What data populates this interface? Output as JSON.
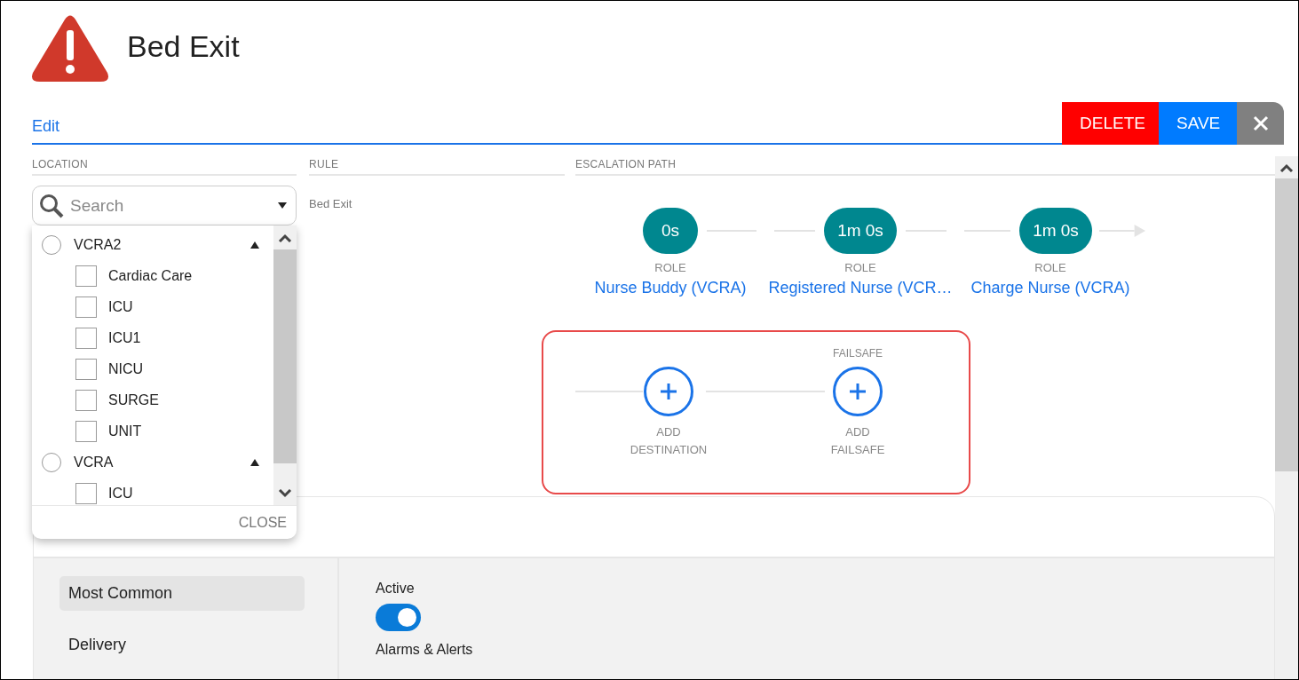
{
  "header": {
    "title": "Bed Exit"
  },
  "tabs": [
    {
      "label": "Edit",
      "selected": true
    }
  ],
  "actions": [
    {
      "kind": "danger",
      "label": "DELETE"
    },
    {
      "kind": "primary",
      "label": "SAVE"
    },
    {
      "kind": "close"
    }
  ],
  "column_headers": [
    "LOCATION",
    "RULE",
    "ESCALATION PATH"
  ],
  "location": {
    "search": {
      "placeholder": "Search"
    },
    "dropdown": {
      "groups": [
        {
          "name": "VCRA2",
          "selected": false,
          "expanded": true,
          "children": [
            {
              "name": "Cardiac Care",
              "checked": false
            },
            {
              "name": "ICU",
              "checked": false
            },
            {
              "name": "ICU1",
              "checked": false
            },
            {
              "name": "NICU",
              "checked": false
            },
            {
              "name": "SURGE",
              "checked": false
            },
            {
              "name": "UNIT",
              "checked": false
            }
          ]
        },
        {
          "name": "VCRA",
          "selected": false,
          "expanded": true,
          "children": [
            {
              "name": "ICU",
              "checked": false
            }
          ]
        }
      ],
      "close_label": "CLOSE"
    }
  },
  "rule": {
    "name": "Bed Exit"
  },
  "escalation": {
    "steps": [
      {
        "delay": "0s",
        "type_label": "ROLE",
        "name": "Nurse Buddy (VCRA)"
      },
      {
        "delay": "1m 0s",
        "type_label": "ROLE",
        "name": "Registered Nurse (VCR…"
      },
      {
        "delay": "1m 0s",
        "type_label": "ROLE",
        "name": "Charge Nurse (VCRA)"
      }
    ],
    "failsafe": {
      "heading": "FAILSAFE",
      "destination_label": "ADD DESTINATION",
      "failsafe_label": "ADD FAILSAFE"
    }
  },
  "settings": {
    "nav": [
      {
        "label": "Most Common",
        "selected": true
      },
      {
        "label": "Delivery",
        "selected": false
      }
    ],
    "fields": [
      {
        "kind": "toggle",
        "label": "Active",
        "on": true
      },
      {
        "kind": "heading",
        "label": "Alarms & Alerts"
      }
    ]
  }
}
